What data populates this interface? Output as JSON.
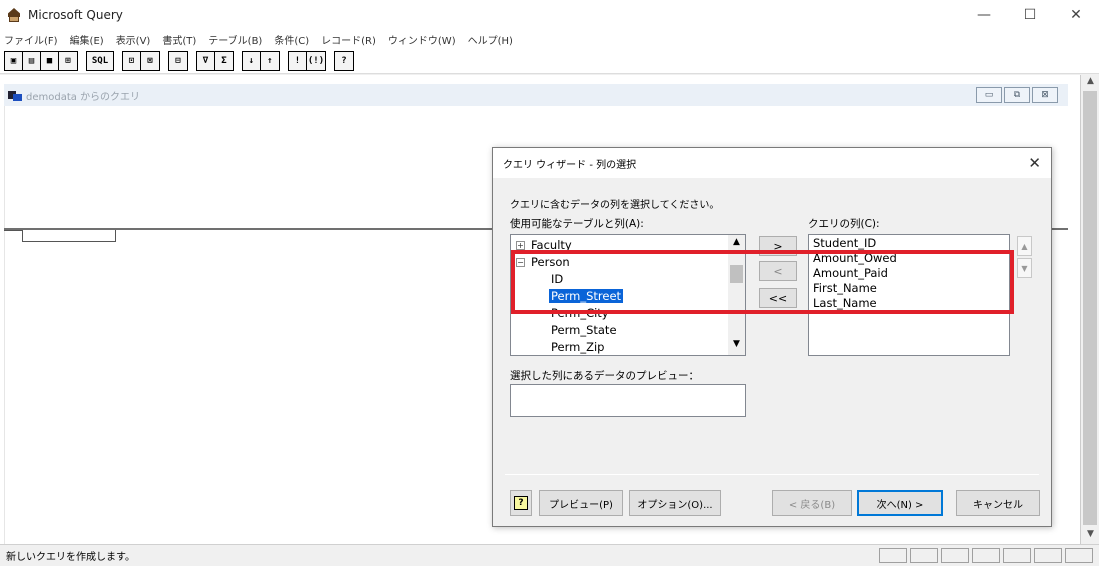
{
  "window": {
    "title": "Microsoft Query",
    "controls": [
      "—",
      "☐",
      "✕"
    ]
  },
  "menu": [
    "ファイル(F)",
    "編集(E)",
    "表示(V)",
    "書式(T)",
    "テーブル(B)",
    "条件(C)",
    "レコード(R)",
    "ウィンドウ(W)",
    "ヘルプ(H)"
  ],
  "toolbar": {
    "groups": [
      [
        "▣",
        "▤",
        "■",
        "⊞"
      ],
      [
        "SQL"
      ],
      [
        "⊡",
        "⊠"
      ],
      [
        "⊟"
      ],
      [
        "∇",
        "Σ"
      ],
      [
        "↓",
        "↑"
      ],
      [
        "!",
        "(!)"
      ],
      [
        "?"
      ]
    ]
  },
  "child_window": {
    "title": "demodata からのクエリ",
    "controls": [
      "▭",
      "⧉",
      "⊠"
    ]
  },
  "wizard": {
    "title": "クエリ ウィザード - 列の選択",
    "close": "✕",
    "prompt": "クエリに含むデータの列を選択してください。",
    "available_label": "使用可能なテーブルと列(A):",
    "query_label": "クエリの列(C):",
    "tree": [
      {
        "text": "Faculty",
        "expander": "+",
        "level": 0
      },
      {
        "text": "Person",
        "expander": "−",
        "level": 0
      },
      {
        "text": "ID",
        "level": 1
      },
      {
        "text": "Perm_Street",
        "level": 1,
        "selected": true
      },
      {
        "text": "Perm_City",
        "level": 1
      },
      {
        "text": "Perm_State",
        "level": 1
      },
      {
        "text": "Perm_Zip",
        "level": 1
      }
    ],
    "query_columns": [
      "Student_ID",
      "Amount_Owed",
      "Amount_Paid",
      "First_Name",
      "Last_Name"
    ],
    "move_buttons": [
      ">",
      "<",
      "<<"
    ],
    "updown": [
      "▲",
      "▼"
    ],
    "preview_label": "選択した列にあるデータのプレビュー：",
    "buttons": {
      "help": "?",
      "preview": "プレビュー(P)",
      "options": "オプション(O)...",
      "back": "< 戻る(B)",
      "next": "次へ(N) >",
      "cancel": "キャンセル"
    }
  },
  "status": {
    "text": "新しいクエリを作成します。"
  },
  "colors": {
    "highlight": "#e0202a",
    "selection": "#0a64d8"
  }
}
